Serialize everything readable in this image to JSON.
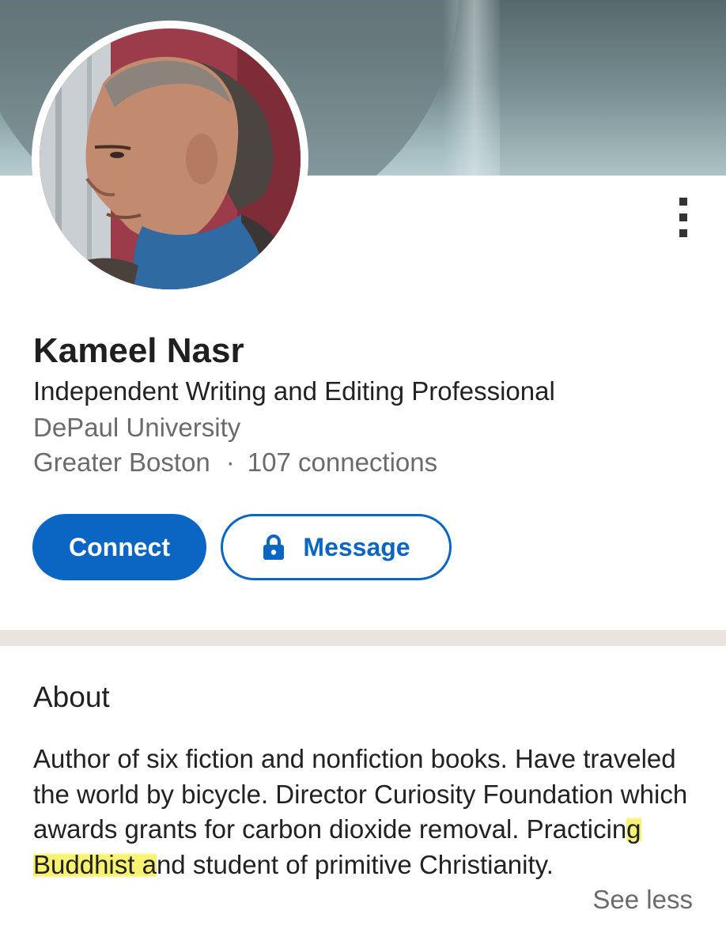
{
  "profile": {
    "name": "Kameel Nasr",
    "headline": "Independent Writing and Editing Professional",
    "school": "DePaul University",
    "location": "Greater Boston",
    "separator": "·",
    "connections": "107 connections"
  },
  "actions": {
    "connect_label": "Connect",
    "message_label": "Message"
  },
  "about": {
    "title": "About",
    "text_before": "Author of six fiction and nonfiction books. Have traveled the world by bicycle. Director Curiosity Foundation which awards grants for carbon dioxide removal. Practicin",
    "text_highlight": "g Buddhist a",
    "text_after": "nd student of primitive Christianity.",
    "see_less_label": "See less"
  },
  "icons": {
    "overflow_menu": "vertical-dots-icon",
    "message_lock": "lock-icon"
  },
  "colors": {
    "accent": "#0a66c2",
    "highlight": "#f6f05a",
    "divider": "#ebe4de"
  }
}
